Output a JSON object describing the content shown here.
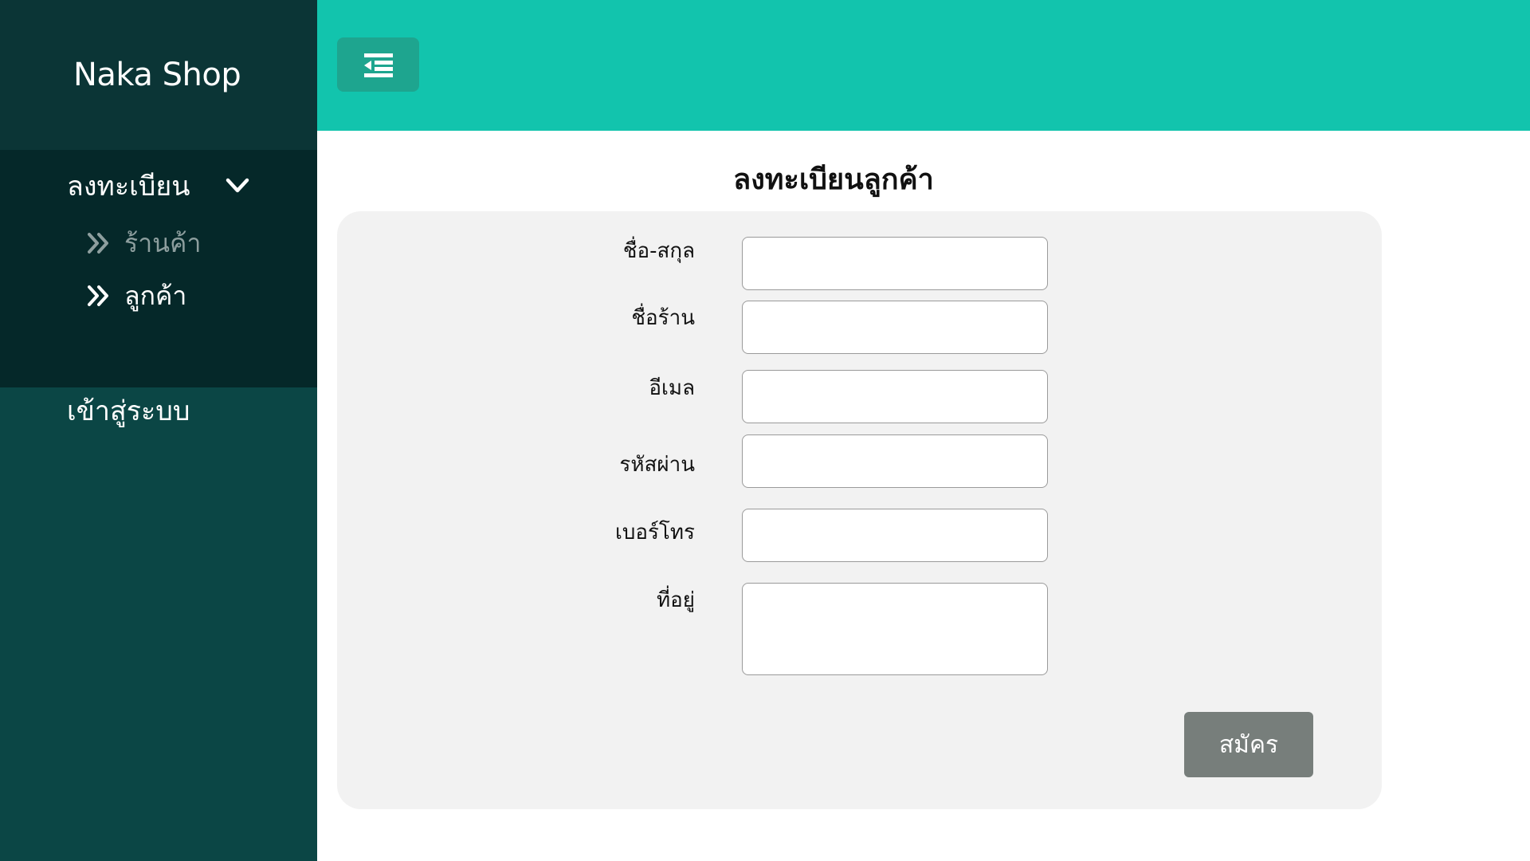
{
  "app": {
    "brand": "Naka Shop"
  },
  "sidebar": {
    "register_group": {
      "label": "ลงทะเบียน",
      "items": [
        {
          "label": "ร้านค้า",
          "state": "inactive"
        },
        {
          "label": "ลูกค้า",
          "state": "active"
        }
      ]
    },
    "login_label": "เข้าสู่ระบบ"
  },
  "main": {
    "title": "ลงทะเบียนลูกค้า",
    "form": {
      "fields": [
        {
          "label": "ชื่อ-สกุล",
          "value": "",
          "placeholder": ""
        },
        {
          "label": "ชื่อร้าน",
          "value": "",
          "placeholder": ""
        },
        {
          "label": "อีเมล",
          "value": "",
          "placeholder": ""
        },
        {
          "label": "รหัสผ่าน",
          "value": "",
          "placeholder": ""
        },
        {
          "label": "เบอร์โทร",
          "value": "",
          "placeholder": ""
        },
        {
          "label": "ที่อยู่",
          "value": "",
          "placeholder": ""
        }
      ],
      "submit_label": "สมัคร"
    }
  },
  "colors": {
    "sidebar_bg": "#0b4645",
    "brand_bg": "#0b3536",
    "submenu_bg": "#052829",
    "topbar_bg": "#12c4ad",
    "toggle_bg": "#1ea58f",
    "card_bg": "#f2f2f2",
    "submit_bg": "#777e7b"
  },
  "icons": {
    "toggle": "menu-collapse-icon",
    "group_caret": "chevron-down-icon",
    "submenu_bullet": "double-chevron-right-icon"
  }
}
